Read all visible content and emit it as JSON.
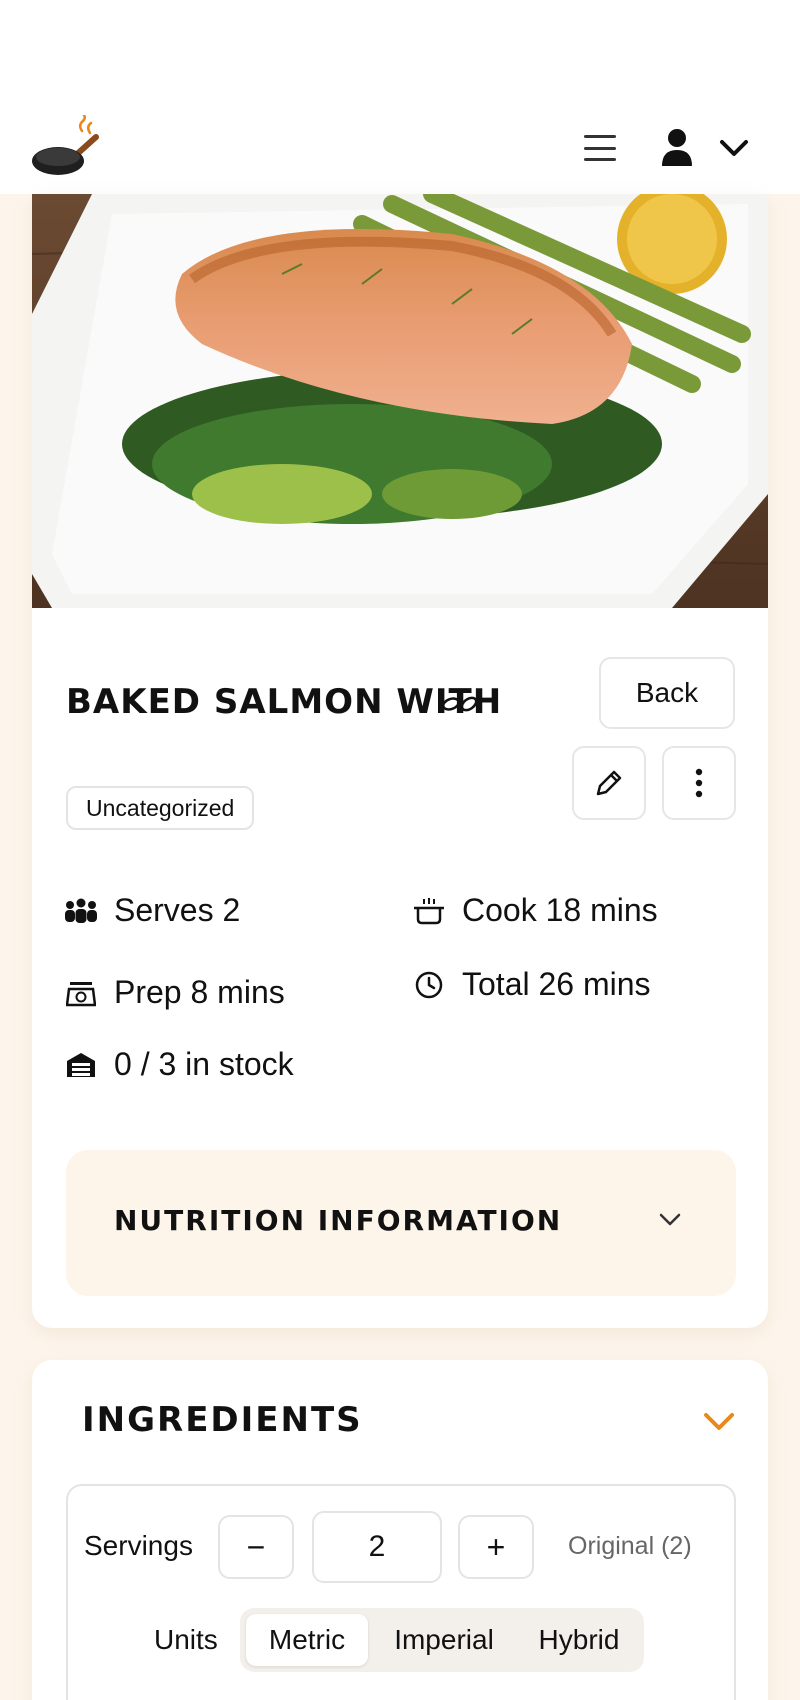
{
  "header": {
    "logo_icon": "frying-pan-icon",
    "menu_icon": "hamburger-menu-icon",
    "user_icon": "user-icon",
    "user_dropdown_icon": "chevron-down-icon"
  },
  "recipe": {
    "image_alt": "baked-salmon-photo",
    "title": "BAKED SALMON WITH",
    "category": "Uncategorized",
    "actions": {
      "back_label": "Back",
      "edit_icon": "pencil-icon",
      "more_icon": "more-vertical-icon"
    },
    "stats": {
      "serves": "Serves 2",
      "prep": "Prep 8 mins",
      "stock": "0 / 3 in stock",
      "cook": "Cook 18 mins",
      "total": "Total 26 mins"
    },
    "nutrition": {
      "label": "NUTRITION INFORMATION"
    }
  },
  "ingredients": {
    "title": "INGREDIENTS",
    "servings_label": "Servings",
    "minus_label": "−",
    "plus_label": "+",
    "servings_value": "2",
    "original_label": "Original (2)",
    "units_label": "Units",
    "units_options": [
      "Metric",
      "Imperial",
      "Hybrid"
    ],
    "units_selected": "Metric"
  },
  "colors": {
    "page_background": "#fdf5ec",
    "accent": "#e8891a",
    "nutrition_background": "#fdf4ea"
  }
}
